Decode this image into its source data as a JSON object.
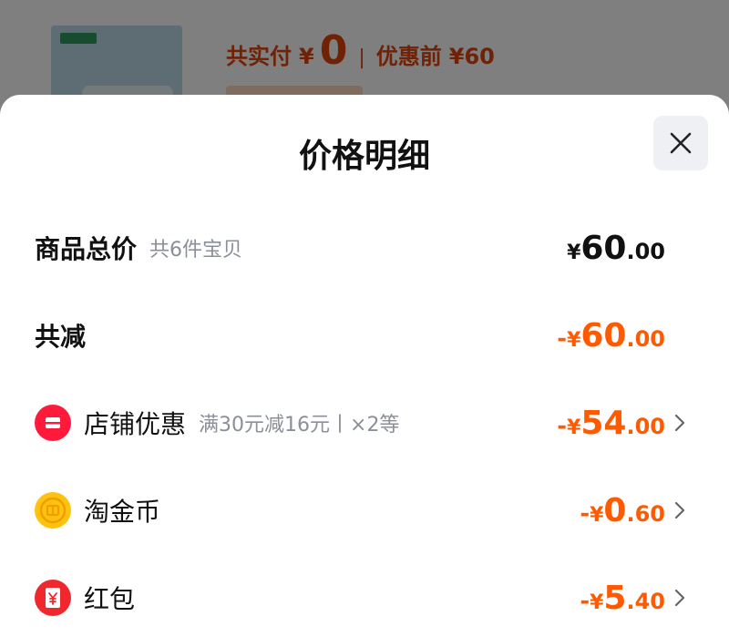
{
  "background": {
    "summary": {
      "paid_label": "共实付",
      "currency": "¥",
      "paid_amount": "0",
      "separator": "|",
      "before_label": "优惠前",
      "before_amount": "¥60"
    }
  },
  "sheet": {
    "title": "价格明细",
    "close_icon": "close-icon"
  },
  "rows": {
    "total": {
      "label": "商品总价",
      "sub": "共6件宝贝",
      "sign": "",
      "currency": "¥",
      "int": "60",
      "dec": ".00"
    },
    "reduction": {
      "label": "共减",
      "sign": "-",
      "currency": "¥",
      "int": "60",
      "dec": ".00"
    },
    "store": {
      "icon": "store-coupon-icon",
      "label": "店铺优惠",
      "sub": "满30元减16元丨×2等",
      "sign": "-",
      "currency": "¥",
      "int": "54",
      "dec": ".00"
    },
    "coins": {
      "icon": "taojinbi-coin-icon",
      "label": "淘金币",
      "sign": "-",
      "currency": "¥",
      "int": "0",
      "dec": ".60"
    },
    "redpacket": {
      "icon": "red-packet-icon",
      "label": "红包",
      "sign": "-",
      "currency": "¥",
      "int": "5",
      "dec": ".40"
    }
  },
  "colors": {
    "accent_orange": "#ff5a00",
    "bg_summary_red": "#e0440e",
    "text_dark": "#111111",
    "text_gray": "#8a8f99",
    "store_icon_red": "#ff1a3c",
    "coin_yellow": "#ffc20e",
    "redpacket_red": "#f0282d"
  }
}
